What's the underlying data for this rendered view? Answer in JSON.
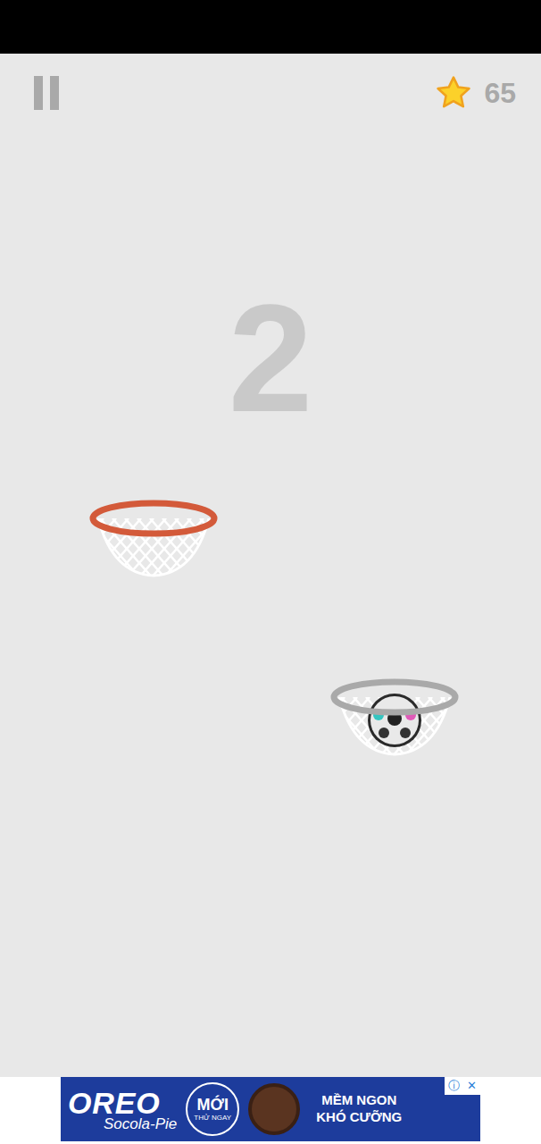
{
  "stars": "65",
  "score": "2",
  "hoops": [
    {
      "color": "#d35a3a",
      "has_ball": false
    },
    {
      "color": "#a9a9a9",
      "has_ball": true
    }
  ],
  "ad": {
    "brand": "OREO",
    "product": "Socola-Pie",
    "badge": "MỚI",
    "badge_sub": "THỬ NGAY",
    "tagline": [
      "MỀM NGON",
      "KHÓ CƯỠNG"
    ],
    "info": "ⓘ",
    "close": "✕"
  }
}
